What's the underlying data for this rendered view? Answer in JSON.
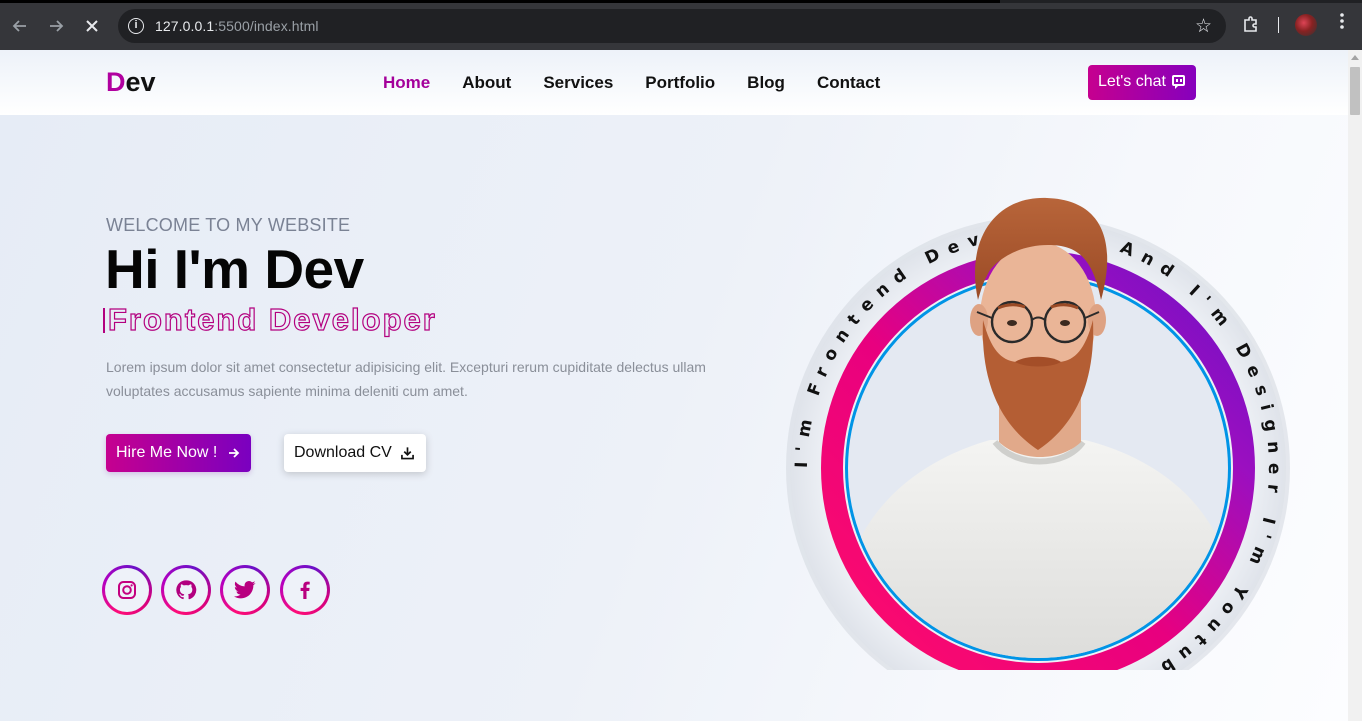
{
  "browser": {
    "url_host": "127.0.0.1",
    "url_rest": ":5500/index.html",
    "back_icon": "arrow-left-icon",
    "forward_icon": "arrow-right-icon",
    "stop_icon": "close-icon"
  },
  "site": {
    "logo_first": "D",
    "logo_rest": "ev",
    "nav": [
      "Home",
      "About",
      "Services",
      "Portfolio",
      "Blog",
      "Contact"
    ],
    "active_nav": "Home",
    "chat_label": "Let's chat"
  },
  "hero": {
    "welcome": "WELCOME TO MY WEBSITE",
    "headline": "Hi I'm Dev",
    "role": "Frontend Developer",
    "description": "Lorem ipsum dolor sit amet consectetur adipisicing elit. Excepturi rerum cupiditate delectus ullam voluptates accusamus sapiente minima deleniti cum amet.",
    "hire_label": "Hire Me Now !",
    "cv_label": "Download CV",
    "ring_text": "I'm Frontend Developer And I'm Designer I'm Youtuber And ",
    "socials": [
      "instagram-icon",
      "github-icon",
      "twitter-icon",
      "facebook-icon"
    ]
  },
  "colors": {
    "accent": "#b1009f",
    "gradient_start": "#c6008f",
    "gradient_end": "#7a00c0",
    "ring_pink": "#ff0d77",
    "ring_blue": "#0094e6"
  }
}
